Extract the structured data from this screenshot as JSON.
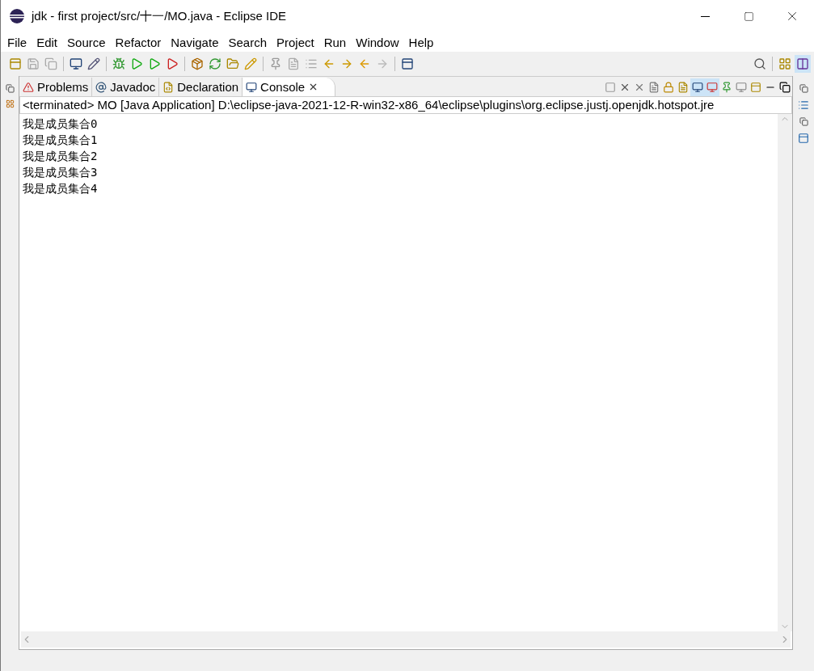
{
  "window": {
    "title": "jdk - first project/src/十一/MO.java - Eclipse IDE"
  },
  "menu": [
    "File",
    "Edit",
    "Source",
    "Refactor",
    "Navigate",
    "Search",
    "Project",
    "Run",
    "Window",
    "Help"
  ],
  "tabs": [
    {
      "label": "Problems",
      "selected": false
    },
    {
      "label": "Javadoc",
      "selected": false
    },
    {
      "label": "Declaration",
      "selected": false
    },
    {
      "label": "Console",
      "selected": true
    }
  ],
  "console": {
    "header": "<terminated> MO [Java Application] D:\\eclipse-java-2021-12-R-win32-x86_64\\eclipse\\plugins\\org.eclipse.justj.openjdk.hotspot.jre",
    "lines": [
      "我是成员集合0",
      "我是成员集合1",
      "我是成员集合2",
      "我是成员集合3",
      "我是成员集合4"
    ]
  }
}
